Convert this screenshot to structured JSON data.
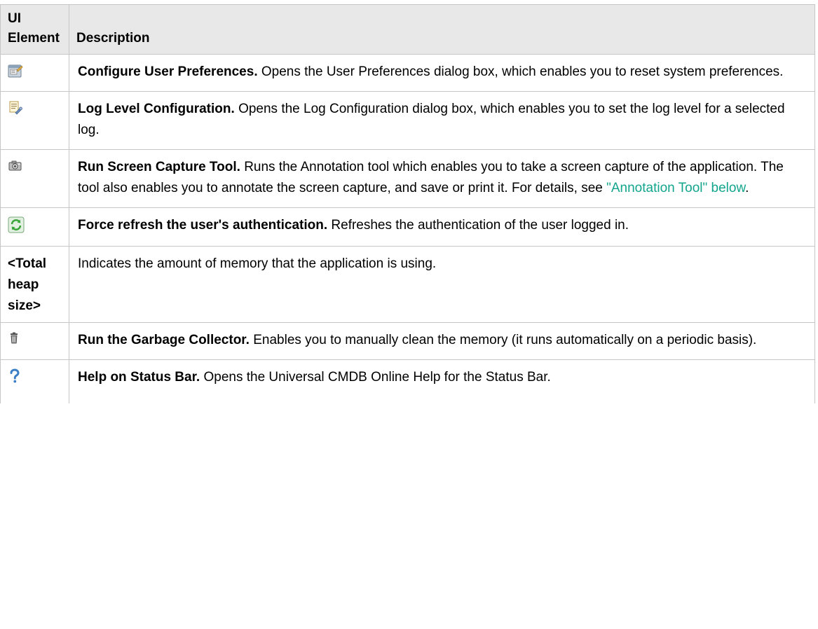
{
  "header": {
    "col_element": "UI Element",
    "col_description": "Description"
  },
  "rows": [
    {
      "icon": "user-preferences-icon",
      "term": "Configure User Preferences.",
      "text": "Opens the User Preferences dialog box, which enables you to reset system preferences."
    },
    {
      "icon": "log-level-configuration-icon",
      "term": "Log Level Configuration.",
      "text": "Opens the Log Configuration dialog box, which enables you to set the log level for a selected log."
    },
    {
      "icon": "camera-icon",
      "term": "Run Screen Capture Tool.",
      "text": "Runs the Annotation tool which enables you to take a screen capture of the application. The tool also enables you to annotate the screen capture, and save or print it. For details, see",
      "link": "\"Annotation Tool\" below",
      "suffix": "."
    },
    {
      "icon": "refresh-icon",
      "term": "Force refresh the user's authentication.",
      "text": "Refreshes the authentication of the user logged in."
    },
    {
      "element_text": "<Total heap size>",
      "text": "Indicates the amount of memory that the application is using."
    },
    {
      "icon": "trash-icon",
      "term": "Run the Garbage Collector.",
      "text": "Enables you to manually clean the memory (it runs automatically on a periodic basis)."
    },
    {
      "icon": "help-icon",
      "term": "Help on Status Bar.",
      "text": "Opens the Universal CMDB Online Help for the Status Bar."
    }
  ],
  "colors": {
    "header_bg": "#e8e8e8",
    "border": "#c6c6c6",
    "link": "#12a58c",
    "refresh_green": "#3aa63a",
    "help_blue": "#3c7fc4"
  }
}
